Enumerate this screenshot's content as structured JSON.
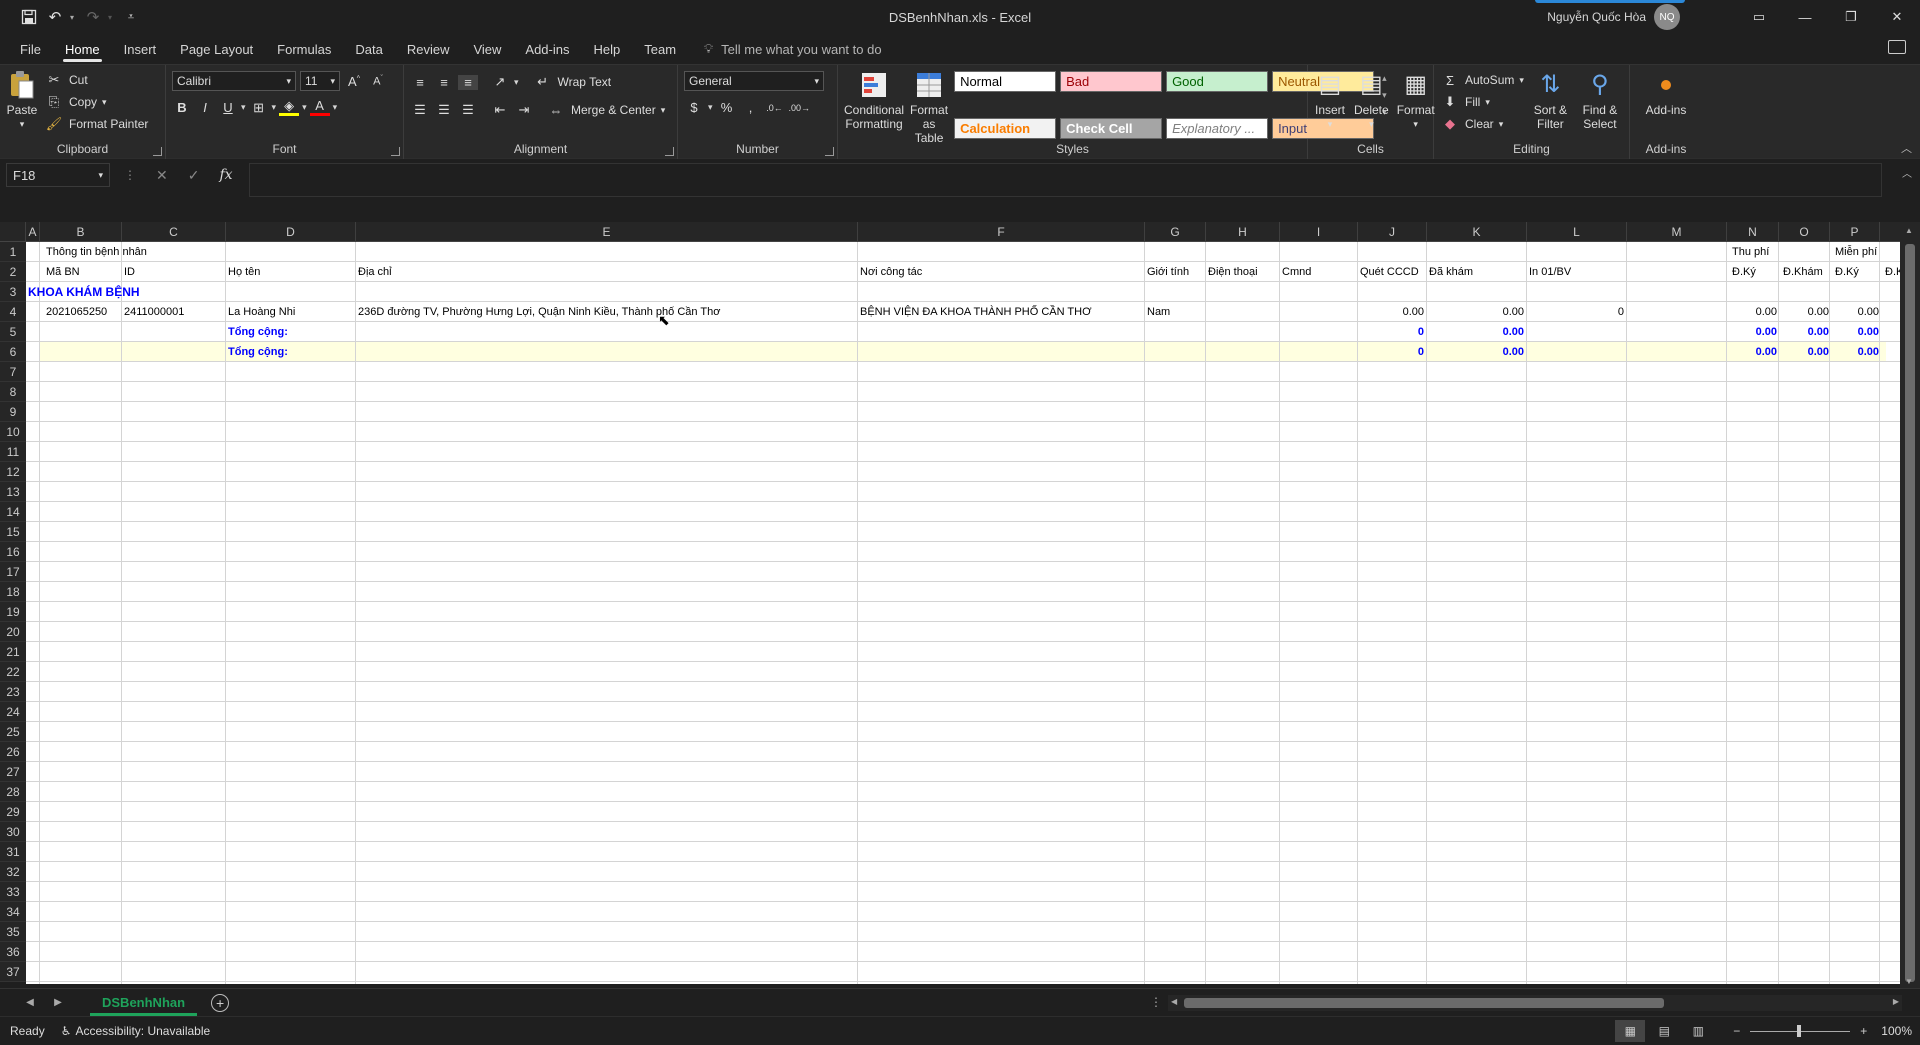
{
  "window": {
    "title": "DSBenhNhan.xls  -  Excel",
    "user_name": "Nguyễn Quốc Hòa",
    "user_initials": "NQ"
  },
  "menu": {
    "tabs": [
      "File",
      "Home",
      "Insert",
      "Page Layout",
      "Formulas",
      "Data",
      "Review",
      "View",
      "Add-ins",
      "Help",
      "Team"
    ],
    "active_tab": "Home",
    "tell_me": "Tell me what you want to do"
  },
  "ribbon": {
    "clipboard": {
      "paste": "Paste",
      "cut": "Cut",
      "copy": "Copy",
      "format_painter": "Format Painter",
      "label": "Clipboard"
    },
    "font": {
      "name": "Calibri",
      "size": "11",
      "label": "Font",
      "bold": "B",
      "italic": "I",
      "underline": "U"
    },
    "alignment": {
      "wrap_text": "Wrap Text",
      "merge_center": "Merge & Center",
      "label": "Alignment"
    },
    "number": {
      "format": "General",
      "label": "Number"
    },
    "styles": {
      "conditional": "Conditional Formatting",
      "format_table": "Format as Table",
      "label": "Styles",
      "cells": [
        {
          "name": "Normal",
          "bg": "#ffffff",
          "fg": "#000000"
        },
        {
          "name": "Bad",
          "bg": "#ffc7ce",
          "fg": "#9c0006"
        },
        {
          "name": "Good",
          "bg": "#c6efce",
          "fg": "#006100"
        },
        {
          "name": "Neutral",
          "bg": "#ffeb9c",
          "fg": "#9c5700"
        },
        {
          "name": "Calculation",
          "bg": "#f2f2f2",
          "fg": "#fa7d00"
        },
        {
          "name": "Check Cell",
          "bg": "#a5a5a5",
          "fg": "#ffffff"
        },
        {
          "name": "Explanatory ...",
          "bg": "#ffffff",
          "fg": "#7f7f7f"
        },
        {
          "name": "Input",
          "bg": "#ffcc99",
          "fg": "#3f3f76"
        }
      ]
    },
    "cells": {
      "insert": "Insert",
      "delete": "Delete",
      "format": "Format",
      "label": "Cells"
    },
    "editing": {
      "autosum": "AutoSum",
      "fill": "Fill",
      "clear": "Clear",
      "sort_filter": "Sort & Filter",
      "find_select": "Find & Select",
      "label": "Editing"
    },
    "addins": {
      "addins": "Add-ins",
      "label": "Add-ins"
    }
  },
  "formula_bar": {
    "name_box": "F18",
    "fx": "fx",
    "content": ""
  },
  "columns": [
    "A",
    "B",
    "C",
    "D",
    "E",
    "F",
    "G",
    "H",
    "I",
    "J",
    "K",
    "L",
    "M",
    "N",
    "O",
    "P"
  ],
  "rows": [
    "1",
    "2",
    "3",
    "4",
    "5",
    "6",
    "7",
    "8",
    "9",
    "10",
    "11",
    "12",
    "13",
    "14",
    "15",
    "16",
    "17",
    "18",
    "19",
    "20",
    "21",
    "22",
    "23",
    "24",
    "25",
    "26",
    "27",
    "28",
    "29",
    "30",
    "31",
    "32",
    "33",
    "34",
    "35",
    "36",
    "37"
  ],
  "sheet": {
    "r1": {
      "b": "Thông tin bệnh nhân",
      "n": "Thu phí",
      "p": "Miễn phí"
    },
    "r2": {
      "b": "Mã BN",
      "c": "ID",
      "d": "Họ tên",
      "e": "Địa chỉ",
      "f": "Nơi công tác",
      "g": "Giới tính",
      "h": "Điện thoại",
      "i": "Cmnd",
      "j": "Quét CCCD",
      "k": "Đã khám",
      "l": "In 01/BV",
      "n": "Đ.Ký",
      "o": "Đ.Khám",
      "p": "Đ.Ký",
      "q": "Đ.K"
    },
    "r3": {
      "a": "KHOA KHÁM BỆNH"
    },
    "r4": {
      "b": "2021065250",
      "c": "2411000001",
      "d": "La Hoàng Nhi",
      "e": "236D đường TV, Phường Hưng Lợi, Quận Ninh Kiều, Thành phố Cần Thơ",
      "f": "BỆNH VIỆN ĐA KHOA THÀNH PHỐ CẦN THƠ",
      "g": "Nam",
      "j": "0.00",
      "k": "0.00",
      "l": "0",
      "n": "0.00",
      "o": "0.00",
      "p": "0.00"
    },
    "r5": {
      "d": "Tổng cộng:",
      "j": "0",
      "k": "0.00",
      "n": "0.00",
      "o": "0.00",
      "p": "0.00"
    },
    "r6": {
      "d": "Tổng cộng:",
      "j": "0",
      "k": "0.00",
      "n": "0.00",
      "o": "0.00",
      "p": "0.00"
    }
  },
  "sheet_tabs": [
    "DSBenhNhan"
  ],
  "status": {
    "ready": "Ready",
    "accessibility": "Accessibility: Unavailable",
    "zoom": "100%"
  }
}
